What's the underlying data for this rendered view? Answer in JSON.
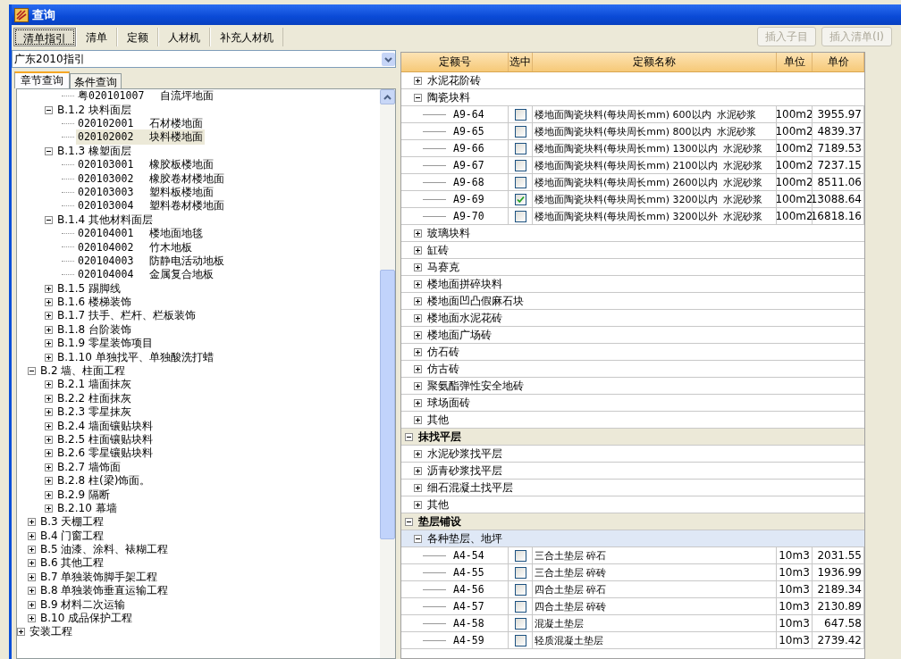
{
  "window": {
    "title": "查询"
  },
  "tabs": [
    {
      "label": "清单指引",
      "selected": true
    },
    {
      "label": "清单",
      "selected": false
    },
    {
      "label": "定额",
      "selected": false
    },
    {
      "label": "人材机",
      "selected": false
    },
    {
      "label": "补充人材机",
      "selected": false
    }
  ],
  "actions": [
    {
      "label": "插入子目",
      "disabled": true
    },
    {
      "label": "插入清单(I)",
      "disabled": true
    }
  ],
  "guide_select": {
    "value": "广东2010指引"
  },
  "panel_tabs": [
    {
      "label": "章节查询",
      "selected": true
    },
    {
      "label": "条件查询",
      "selected": false
    }
  ],
  "tree": [
    {
      "children": [
        {
          "children": [
            {
              "children": [
                {
                  "code": "粤020101007",
                  "label": "自流坪地面",
                  "selected": false
                }
              ]
            },
            {
              "label": "B.1.2 块料面层",
              "expanded": true,
              "selected": false,
              "children": [
                {
                  "code": "020102001",
                  "label": "石材楼地面",
                  "selected": false
                },
                {
                  "code": "020102002",
                  "label": "块料楼地面",
                  "selected": true
                }
              ]
            },
            {
              "label": "B.1.3 橡塑面层",
              "expanded": true,
              "selected": false,
              "children": [
                {
                  "code": "020103001",
                  "label": "橡胶板楼地面",
                  "selected": false
                },
                {
                  "code": "020103002",
                  "label": "橡胶卷材楼地面",
                  "selected": false
                },
                {
                  "code": "020103003",
                  "label": "塑料板楼地面",
                  "selected": false
                },
                {
                  "code": "020103004",
                  "label": "塑料卷材楼地面",
                  "selected": false
                }
              ]
            },
            {
              "label": "B.1.4 其他材料面层",
              "expanded": true,
              "selected": false,
              "children": [
                {
                  "code": "020104001",
                  "label": "楼地面地毯",
                  "selected": false
                },
                {
                  "code": "020104002",
                  "label": "竹木地板",
                  "selected": false
                },
                {
                  "code": "020104003",
                  "label": "防静电活动地板",
                  "selected": false
                },
                {
                  "code": "020104004",
                  "label": "金属复合地板",
                  "selected": false
                }
              ]
            },
            {
              "label": "B.1.5 踢脚线",
              "expanded": false,
              "selected": false
            },
            {
              "label": "B.1.6 楼梯装饰",
              "expanded": false,
              "selected": false
            },
            {
              "label": "B.1.7 扶手、栏杆、栏板装饰",
              "expanded": false,
              "selected": false
            },
            {
              "label": "B.1.8 台阶装饰",
              "expanded": false,
              "selected": false
            },
            {
              "label": "B.1.9 零星装饰项目",
              "expanded": false,
              "selected": false
            },
            {
              "label": "B.1.10 单独找平、单独酸洗打蜡",
              "expanded": false,
              "selected": false
            }
          ]
        },
        {
          "label": "B.2 墙、柱面工程",
          "expanded": true,
          "selected": false,
          "children": [
            {
              "label": "B.2.1 墙面抹灰",
              "expanded": false,
              "selected": false
            },
            {
              "label": "B.2.2 柱面抹灰",
              "expanded": false,
              "selected": false
            },
            {
              "label": "B.2.3 零星抹灰",
              "expanded": false,
              "selected": false
            },
            {
              "label": "B.2.4 墙面镶贴块料",
              "expanded": false,
              "selected": false
            },
            {
              "label": "B.2.5 柱面镶贴块料",
              "expanded": false,
              "selected": false
            },
            {
              "label": "B.2.6 零星镶贴块料",
              "expanded": false,
              "selected": false
            },
            {
              "label": "B.2.7 墙饰面",
              "expanded": false,
              "selected": false
            },
            {
              "label": "B.2.8 柱(梁)饰面。",
              "expanded": false,
              "selected": false
            },
            {
              "label": "B.2.9 隔断",
              "expanded": false,
              "selected": false
            },
            {
              "label": "B.2.10 幕墙",
              "expanded": false,
              "selected": false
            }
          ]
        },
        {
          "label": "B.3 天棚工程",
          "expanded": false,
          "selected": false
        },
        {
          "label": "B.4 门窗工程",
          "expanded": false,
          "selected": false
        },
        {
          "label": "B.5 油漆、涂料、裱糊工程",
          "expanded": false,
          "selected": false
        },
        {
          "label": "B.6 其他工程",
          "expanded": false,
          "selected": false
        },
        {
          "label": "B.7 单独装饰脚手架工程",
          "expanded": false,
          "selected": false
        },
        {
          "label": "B.8 单独装饰垂直运输工程",
          "expanded": false,
          "selected": false
        },
        {
          "label": "B.9 材料二次运输",
          "expanded": false,
          "selected": false
        },
        {
          "label": "B.10 成品保护工程",
          "expanded": false,
          "selected": false
        }
      ]
    },
    {
      "label": "安装工程",
      "expanded": false,
      "selected": false
    }
  ],
  "table": {
    "columns": [
      "定额号",
      "选中",
      "定额名称",
      "单位",
      "单价"
    ],
    "rows": [
      {
        "kind": "hidden",
        "children": [
          {
            "kind": "group",
            "label": "水泥花阶砖",
            "expanded": false,
            "selected": false
          },
          {
            "kind": "group",
            "label": "陶瓷块料",
            "expanded": true,
            "selected": false,
            "children": [
              {
                "kind": "item",
                "code": "A9-64",
                "checked": false,
                "name": "楼地面陶瓷块料(每块周长mm) 600以内  水泥砂浆",
                "unit": "100m2",
                "price": "3955.97"
              },
              {
                "kind": "item",
                "code": "A9-65",
                "checked": false,
                "name": "楼地面陶瓷块料(每块周长mm) 800以内  水泥砂浆",
                "unit": "100m2",
                "price": "4839.37"
              },
              {
                "kind": "item",
                "code": "A9-66",
                "checked": false,
                "name": "楼地面陶瓷块料(每块周长mm) 1300以内  水泥砂浆",
                "unit": "100m2",
                "price": "7189.53"
              },
              {
                "kind": "item",
                "code": "A9-67",
                "checked": false,
                "name": "楼地面陶瓷块料(每块周长mm) 2100以内  水泥砂浆",
                "unit": "100m2",
                "price": "7237.15"
              },
              {
                "kind": "item",
                "code": "A9-68",
                "checked": false,
                "name": "楼地面陶瓷块料(每块周长mm) 2600以内  水泥砂浆",
                "unit": "100m2",
                "price": "8511.06"
              },
              {
                "kind": "item",
                "code": "A9-69",
                "checked": true,
                "name": "楼地面陶瓷块料(每块周长mm) 3200以内  水泥砂浆",
                "unit": "100m2",
                "price": "13088.64"
              },
              {
                "kind": "item",
                "code": "A9-70",
                "checked": false,
                "name": "楼地面陶瓷块料(每块周长mm) 3200以外  水泥砂浆",
                "unit": "100m2",
                "price": "16818.16"
              }
            ]
          },
          {
            "kind": "group",
            "label": "玻璃块料",
            "expanded": false,
            "selected": false
          },
          {
            "kind": "group",
            "label": "缸砖",
            "expanded": false,
            "selected": false
          },
          {
            "kind": "group",
            "label": "马赛克",
            "expanded": false,
            "selected": false
          },
          {
            "kind": "group",
            "label": "楼地面拼碎块料",
            "expanded": false,
            "selected": false
          },
          {
            "kind": "group",
            "label": "楼地面凹凸假麻石块",
            "expanded": false,
            "selected": false
          },
          {
            "kind": "group",
            "label": "楼地面水泥花砖",
            "expanded": false,
            "selected": false
          },
          {
            "kind": "group",
            "label": "楼地面广场砖",
            "expanded": false,
            "selected": false
          },
          {
            "kind": "group",
            "label": "仿石砖",
            "expanded": false,
            "selected": false
          },
          {
            "kind": "group",
            "label": "仿古砖",
            "expanded": false,
            "selected": false
          },
          {
            "kind": "group",
            "label": "聚氨酯弹性安全地砖",
            "expanded": false,
            "selected": false
          },
          {
            "kind": "group",
            "label": "球场面砖",
            "expanded": false,
            "selected": false
          },
          {
            "kind": "group",
            "label": "其他",
            "expanded": false,
            "selected": false
          }
        ]
      },
      {
        "kind": "section",
        "label": "抹找平层",
        "expanded": true,
        "selected": false,
        "children": [
          {
            "kind": "group",
            "label": "水泥砂浆找平层",
            "expanded": false,
            "selected": false
          },
          {
            "kind": "group",
            "label": "沥青砂浆找平层",
            "expanded": false,
            "selected": false
          },
          {
            "kind": "group",
            "label": "细石混凝土找平层",
            "expanded": false,
            "selected": false
          },
          {
            "kind": "group",
            "label": "其他",
            "expanded": false,
            "selected": false
          }
        ]
      },
      {
        "kind": "section",
        "label": "垫层铺设",
        "expanded": true,
        "selected": false,
        "children": [
          {
            "kind": "group",
            "label": "各种垫层、地坪",
            "expanded": true,
            "selected": true,
            "children": [
              {
                "kind": "item",
                "code": "A4-54",
                "checked": false,
                "name": "三合土垫层 碎石",
                "unit": "10m3",
                "price": "2031.55"
              },
              {
                "kind": "item",
                "code": "A4-55",
                "checked": false,
                "name": "三合土垫层 碎砖",
                "unit": "10m3",
                "price": "1936.99"
              },
              {
                "kind": "item",
                "code": "A4-56",
                "checked": false,
                "name": "四合土垫层 碎石",
                "unit": "10m3",
                "price": "2189.34"
              },
              {
                "kind": "item",
                "code": "A4-57",
                "checked": false,
                "name": "四合土垫层 碎砖",
                "unit": "10m3",
                "price": "2130.89"
              },
              {
                "kind": "item",
                "code": "A4-58",
                "checked": false,
                "name": "混凝土垫层",
                "unit": "10m3",
                "price": "647.58"
              },
              {
                "kind": "item",
                "code": "A4-59",
                "checked": false,
                "name": "轻质混凝土垫层",
                "unit": "10m3",
                "price": "2739.42"
              }
            ]
          }
        ]
      }
    ]
  }
}
